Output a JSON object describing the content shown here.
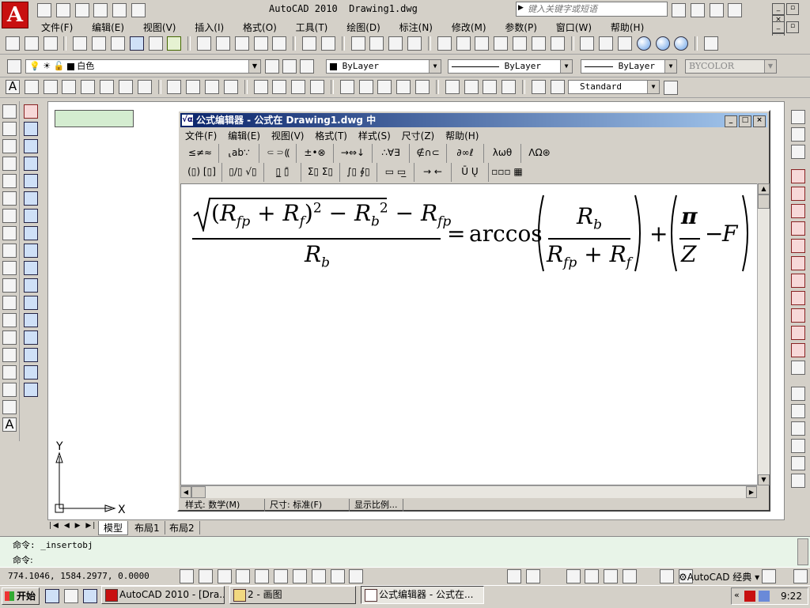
{
  "app": {
    "title": "AutoCAD 2010",
    "drawing": "Drawing1.dwg",
    "search_placeholder": "键入关键字或短语"
  },
  "main_menu": [
    "文件(F)",
    "编辑(E)",
    "视图(V)",
    "插入(I)",
    "格式(O)",
    "工具(T)",
    "绘图(D)",
    "标注(N)",
    "修改(M)",
    "参数(P)",
    "窗口(W)",
    "帮助(H)"
  ],
  "layer": {
    "color_name": "白色",
    "color": "#ffffff"
  },
  "properties": {
    "color": "ByLayer",
    "linetype": "ByLayer",
    "lineweight": "ByLayer",
    "plotstyle": "BYCOLOR"
  },
  "dim_style": "Standard",
  "equation_editor": {
    "title": "公式编辑器 - 公式在 Drawing1.dwg 中",
    "menu": [
      "文件(F)",
      "编辑(E)",
      "视图(V)",
      "格式(T)",
      "样式(S)",
      "尺寸(Z)",
      "帮助(H)"
    ],
    "palette_row1": [
      "≤≠≈",
      "⸤ab∵",
      "⸦⸧⸨",
      "±•⊗",
      "→⇔↓",
      "∴∀∃",
      "∉∩⊂",
      "∂∞ℓ",
      "λωθ",
      "ΛΩ⊛"
    ],
    "palette_row2": [
      "(▯) [▯]",
      "▯/▯ √▯",
      "▯̲ ▯̄",
      "Σ▯ Σ▯",
      "∫▯ ∮▯",
      "▭ ▭̲",
      "→ ←",
      "Ū Ų",
      "▫▫▫ ▦"
    ],
    "status": {
      "style": "样式: 数学(M)",
      "size": "尺寸: 标准(F)",
      "zoom": "显示比例..."
    },
    "formula": {
      "open_paren": "(",
      "close_paren": ")",
      "r": "R",
      "fp": "fp",
      "f": "f",
      "b": "b",
      "two": "2",
      "plus": "+",
      "minus": "−",
      "equals": "=",
      "arccos": "arccos",
      "pi": "π",
      "z": "Z",
      "F": "F"
    }
  },
  "layout_tabs": [
    "模型",
    "布局1",
    "布局2"
  ],
  "command_history": "命令: _insertobj",
  "command_prompt": "命令:",
  "coordinates": "774.1046, 1584.2977, 0.0000",
  "workspace": "AutoCAD 经典",
  "taskbar": {
    "start": "开始",
    "tasks": [
      "AutoCAD 2010 - [Dra...",
      "2 - 画图",
      "公式编辑器 - 公式在..."
    ],
    "clock": "9:22"
  }
}
